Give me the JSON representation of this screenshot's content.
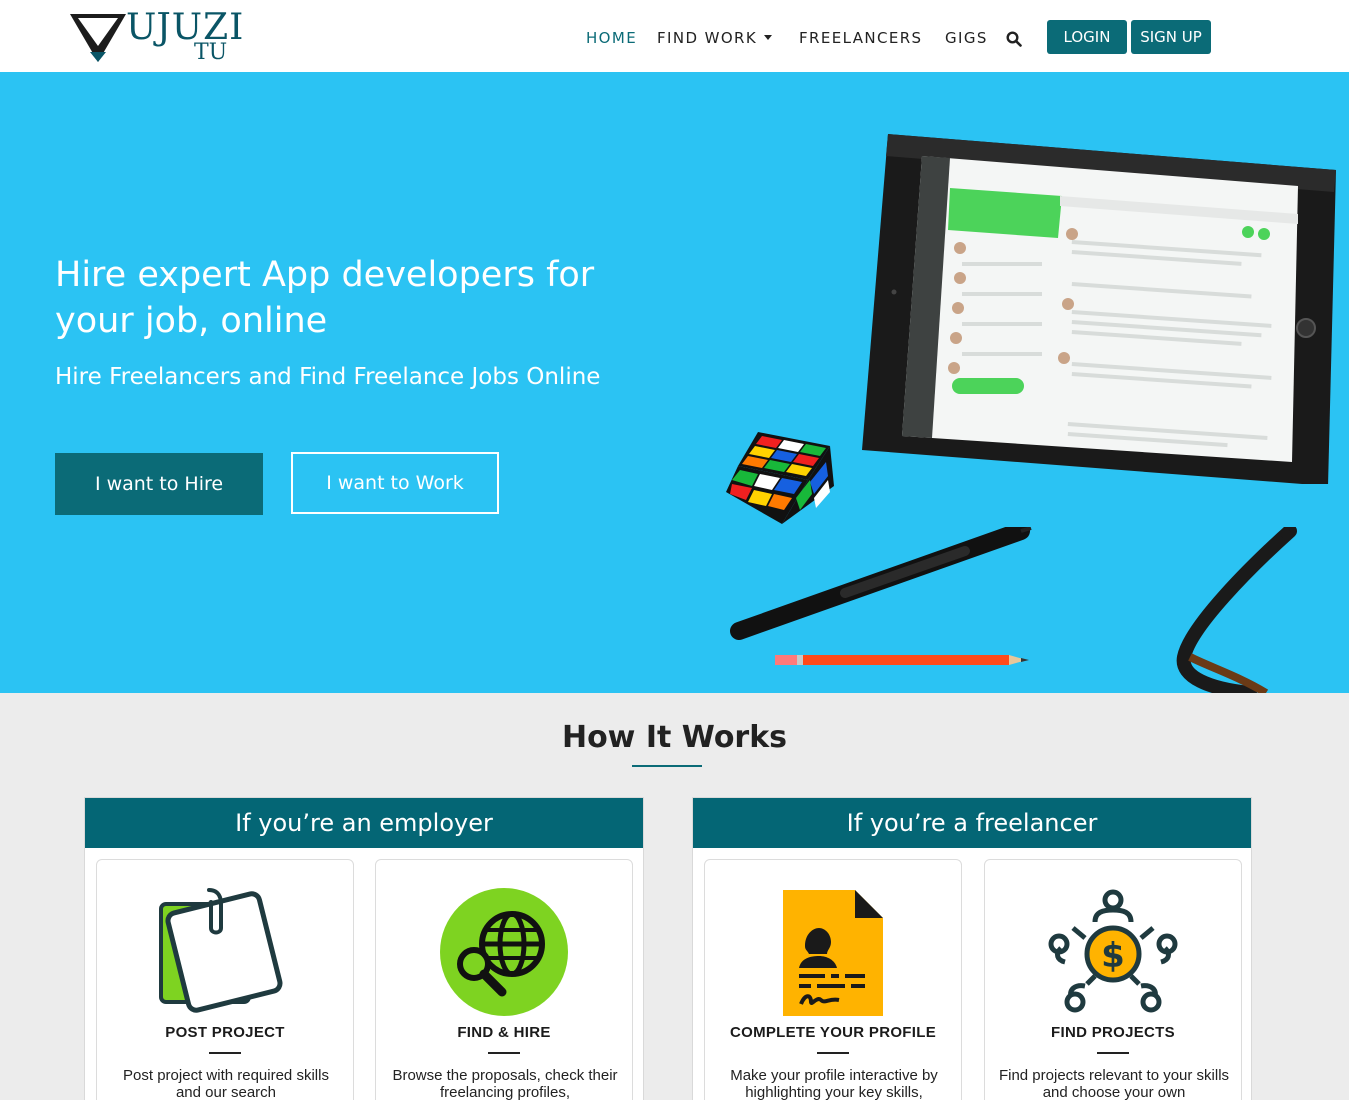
{
  "brand": {
    "name": "UJUZI",
    "sub": "TU"
  },
  "nav": {
    "items": [
      {
        "label": "HOME"
      },
      {
        "label": "FIND WORK"
      },
      {
        "label": "FREELANCERS"
      },
      {
        "label": "GIGS"
      }
    ],
    "search_icon": "search-icon",
    "login": "LOGIN",
    "signup": "SIGN UP"
  },
  "hero": {
    "title": "Hire expert App developers for your job, online",
    "subtitle": "Hire Freelancers and Find Freelance Jobs Online",
    "hire_button": "I want to Hire",
    "work_button": "I want to Work"
  },
  "how_it_works": {
    "title": "How It Works",
    "employer": {
      "heading": "If you’re an employer",
      "cards": [
        {
          "title": "POST PROJECT",
          "desc": "Post project with required skills and our search",
          "icon": "sticky-note-icon"
        },
        {
          "title": "FIND & HIRE",
          "desc": "Browse the proposals, check their freelancing profiles,",
          "icon": "globe-search-icon"
        }
      ]
    },
    "freelancer": {
      "heading": "If you’re a freelancer",
      "cards": [
        {
          "title": "COMPLETE YOUR PROFILE",
          "desc": "Make your profile interactive by highlighting your key skills,",
          "icon": "profile-document-icon"
        },
        {
          "title": "FIND PROJECTS",
          "desc": "Find projects relevant to your skills and choose your own",
          "icon": "dollar-network-icon"
        }
      ]
    }
  },
  "colors": {
    "accent": "#0b6b77",
    "hero_bg": "#2bc3f3",
    "panel_head": "#046675",
    "page_bg": "#ececec"
  }
}
